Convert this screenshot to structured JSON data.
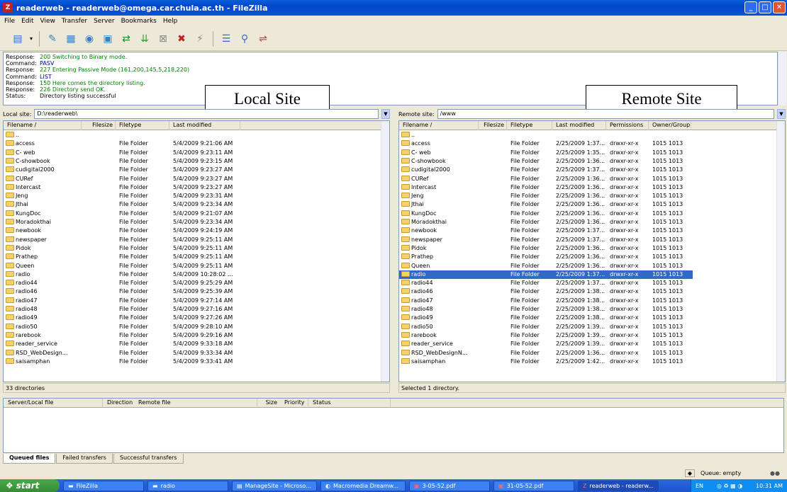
{
  "window": {
    "title": "readerweb - readerweb@omega.car.chula.ac.th - FileZilla",
    "app_icon": "filezilla-icon"
  },
  "menu": [
    "File",
    "Edit",
    "View",
    "Transfer",
    "Server",
    "Bookmarks",
    "Help"
  ],
  "log": [
    {
      "label": "Response:",
      "msg": "200 Switching to Binary mode.",
      "kind": "resp"
    },
    {
      "label": "Command:",
      "msg": "PASV",
      "kind": "cmd"
    },
    {
      "label": "Response:",
      "msg": "227 Entering Passive Mode (161,200,145,5,218,220)",
      "kind": "resp"
    },
    {
      "label": "Command:",
      "msg": "LIST",
      "kind": "cmd"
    },
    {
      "label": "Response:",
      "msg": "150 Here comes the directory listing.",
      "kind": "resp"
    },
    {
      "label": "Response:",
      "msg": "226 Directory send OK.",
      "kind": "resp"
    },
    {
      "label": "Status:",
      "msg": "Directory listing successful",
      "kind": "status"
    }
  ],
  "callouts": {
    "local": "Local Site",
    "remote": "Remote Site"
  },
  "local": {
    "site_label": "Local site:",
    "path": "D:\\readerweb\\",
    "columns": [
      "Filename  /",
      "Filesize",
      "Filetype",
      "Last modified"
    ],
    "rows": [
      {
        "name": "..",
        "type": "",
        "modified": ""
      },
      {
        "name": "access",
        "type": "File Folder",
        "modified": "5/4/2009 9:21:06 AM"
      },
      {
        "name": "C- web",
        "type": "File Folder",
        "modified": "5/4/2009 9:23:11 AM"
      },
      {
        "name": "C-showbook",
        "type": "File Folder",
        "modified": "5/4/2009 9:23:15 AM"
      },
      {
        "name": "cudigital2000",
        "type": "File Folder",
        "modified": "5/4/2009 9:23:27 AM"
      },
      {
        "name": "CURef",
        "type": "File Folder",
        "modified": "5/4/2009 9:23:27 AM"
      },
      {
        "name": "Intercast",
        "type": "File Folder",
        "modified": "5/4/2009 9:23:27 AM"
      },
      {
        "name": "Jeng",
        "type": "File Folder",
        "modified": "5/4/2009 9:23:31 AM"
      },
      {
        "name": "Jthai",
        "type": "File Folder",
        "modified": "5/4/2009 9:23:34 AM"
      },
      {
        "name": "KungDoc",
        "type": "File Folder",
        "modified": "5/4/2009 9:21:07 AM"
      },
      {
        "name": "Moradokthai",
        "type": "File Folder",
        "modified": "5/4/2009 9:23:34 AM"
      },
      {
        "name": "newbook",
        "type": "File Folder",
        "modified": "5/4/2009 9:24:19 AM"
      },
      {
        "name": "newspaper",
        "type": "File Folder",
        "modified": "5/4/2009 9:25:11 AM"
      },
      {
        "name": "Pidok",
        "type": "File Folder",
        "modified": "5/4/2009 9:25:11 AM"
      },
      {
        "name": "Prathep",
        "type": "File Folder",
        "modified": "5/4/2009 9:25:11 AM"
      },
      {
        "name": "Queen",
        "type": "File Folder",
        "modified": "5/4/2009 9:25:11 AM"
      },
      {
        "name": "radio",
        "type": "File Folder",
        "modified": "5/4/2009 10:28:02 ..."
      },
      {
        "name": "radio44",
        "type": "File Folder",
        "modified": "5/4/2009 9:25:29 AM"
      },
      {
        "name": "radio46",
        "type": "File Folder",
        "modified": "5/4/2009 9:25:39 AM"
      },
      {
        "name": "radio47",
        "type": "File Folder",
        "modified": "5/4/2009 9:27:14 AM"
      },
      {
        "name": "radio48",
        "type": "File Folder",
        "modified": "5/4/2009 9:27:16 AM"
      },
      {
        "name": "radio49",
        "type": "File Folder",
        "modified": "5/4/2009 9:27:26 AM"
      },
      {
        "name": "radio50",
        "type": "File Folder",
        "modified": "5/4/2009 9:28:10 AM"
      },
      {
        "name": "rarebook",
        "type": "File Folder",
        "modified": "5/4/2009 9:29:16 AM"
      },
      {
        "name": "reader_service",
        "type": "File Folder",
        "modified": "5/4/2009 9:33:18 AM"
      },
      {
        "name": "RSD_WebDesign...",
        "type": "File Folder",
        "modified": "5/4/2009 9:33:34 AM"
      },
      {
        "name": "saisamphan",
        "type": "File Folder",
        "modified": "5/4/2009 9:33:41 AM"
      }
    ],
    "status": "33 directories"
  },
  "remote": {
    "site_label": "Remote site:",
    "path": "/www",
    "columns": [
      "Filename  /",
      "Filesize",
      "Filetype",
      "Last modified",
      "Permissions",
      "Owner/Group"
    ],
    "rows": [
      {
        "name": "..",
        "type": "",
        "modified": "",
        "perm": "",
        "owner": ""
      },
      {
        "name": "access",
        "type": "File Folder",
        "modified": "2/25/2009 1:37...",
        "perm": "drwxr-xr-x",
        "owner": "1015 1013"
      },
      {
        "name": "C- web",
        "type": "File Folder",
        "modified": "2/25/2009 1:35...",
        "perm": "drwxr-xr-x",
        "owner": "1015 1013"
      },
      {
        "name": "C-showbook",
        "type": "File Folder",
        "modified": "2/25/2009 1:36...",
        "perm": "drwxr-xr-x",
        "owner": "1015 1013"
      },
      {
        "name": "cudigital2000",
        "type": "File Folder",
        "modified": "2/25/2009 1:37...",
        "perm": "drwxr-xr-x",
        "owner": "1015 1013"
      },
      {
        "name": "CURef",
        "type": "File Folder",
        "modified": "2/25/2009 1:36...",
        "perm": "drwxr-xr-x",
        "owner": "1015 1013"
      },
      {
        "name": "Intercast",
        "type": "File Folder",
        "modified": "2/25/2009 1:36...",
        "perm": "drwxr-xr-x",
        "owner": "1015 1013"
      },
      {
        "name": "Jeng",
        "type": "File Folder",
        "modified": "2/25/2009 1:36...",
        "perm": "drwxr-xr-x",
        "owner": "1015 1013"
      },
      {
        "name": "Jthai",
        "type": "File Folder",
        "modified": "2/25/2009 1:36...",
        "perm": "drwxr-xr-x",
        "owner": "1015 1013"
      },
      {
        "name": "KungDoc",
        "type": "File Folder",
        "modified": "2/25/2009 1:36...",
        "perm": "drwxr-xr-x",
        "owner": "1015 1013"
      },
      {
        "name": "Moradokthai",
        "type": "File Folder",
        "modified": "2/25/2009 1:36...",
        "perm": "drwxr-xr-x",
        "owner": "1015 1013"
      },
      {
        "name": "newbook",
        "type": "File Folder",
        "modified": "2/25/2009 1:37...",
        "perm": "drwxr-xr-x",
        "owner": "1015 1013"
      },
      {
        "name": "newspaper",
        "type": "File Folder",
        "modified": "2/25/2009 1:37...",
        "perm": "drwxr-xr-x",
        "owner": "1015 1013"
      },
      {
        "name": "Pidok",
        "type": "File Folder",
        "modified": "2/25/2009 1:36...",
        "perm": "drwxr-xr-x",
        "owner": "1015 1013"
      },
      {
        "name": "Prathep",
        "type": "File Folder",
        "modified": "2/25/2009 1:36...",
        "perm": "drwxr-xr-x",
        "owner": "1015 1013"
      },
      {
        "name": "Queen",
        "type": "File Folder",
        "modified": "2/25/2009 1:36...",
        "perm": "drwxr-xr-x",
        "owner": "1015 1013"
      },
      {
        "name": "radio",
        "type": "File Folder",
        "modified": "2/25/2009 1:37...",
        "perm": "drwxr-xr-x",
        "owner": "1015 1013",
        "selected": true
      },
      {
        "name": "radio44",
        "type": "File Folder",
        "modified": "2/25/2009 1:37...",
        "perm": "drwxr-xr-x",
        "owner": "1015 1013"
      },
      {
        "name": "radio46",
        "type": "File Folder",
        "modified": "2/25/2009 1:38...",
        "perm": "drwxr-xr-x",
        "owner": "1015 1013"
      },
      {
        "name": "radio47",
        "type": "File Folder",
        "modified": "2/25/2009 1:38...",
        "perm": "drwxr-xr-x",
        "owner": "1015 1013"
      },
      {
        "name": "radio48",
        "type": "File Folder",
        "modified": "2/25/2009 1:38...",
        "perm": "drwxr-xr-x",
        "owner": "1015 1013"
      },
      {
        "name": "radio49",
        "type": "File Folder",
        "modified": "2/25/2009 1:38...",
        "perm": "drwxr-xr-x",
        "owner": "1015 1013"
      },
      {
        "name": "radio50",
        "type": "File Folder",
        "modified": "2/25/2009 1:39...",
        "perm": "drwxr-xr-x",
        "owner": "1015 1013"
      },
      {
        "name": "rarebook",
        "type": "File Folder",
        "modified": "2/25/2009 1:39...",
        "perm": "drwxr-xr-x",
        "owner": "1015 1013"
      },
      {
        "name": "reader_service",
        "type": "File Folder",
        "modified": "2/25/2009 1:39...",
        "perm": "drwxr-xr-x",
        "owner": "1015 1013"
      },
      {
        "name": "RSD_WebDesignN...",
        "type": "File Folder",
        "modified": "2/25/2009 1:36...",
        "perm": "drwxr-xr-x",
        "owner": "1015 1013"
      },
      {
        "name": "saisamphan",
        "type": "File Folder",
        "modified": "2/25/2009 1:42...",
        "perm": "drwxr-xr-x",
        "owner": "1015 1013"
      }
    ],
    "status": "Selected 1 directory."
  },
  "queue": {
    "columns": [
      "Server/Local file",
      "Direction",
      "Remote file",
      "Size",
      "Priority",
      "Status"
    ],
    "tabs": [
      "Queued files",
      "Failed transfers",
      "Successful transfers"
    ],
    "status": "Queue: empty"
  },
  "taskbar": {
    "start": "start",
    "tasks": [
      "FileZilla",
      "radio",
      "ManageSite - Microso...",
      "Macromedia Dreamw...",
      "3-05-52.pdf",
      "31-05-52.pdf",
      "readerweb - readerw..."
    ],
    "tray_lang": "EN",
    "clock": "10:31 AM"
  },
  "colors": {
    "titlebar": "#0a52d8",
    "selection": "#316ac5",
    "log_response": "#008000",
    "log_command": "#00008b"
  }
}
